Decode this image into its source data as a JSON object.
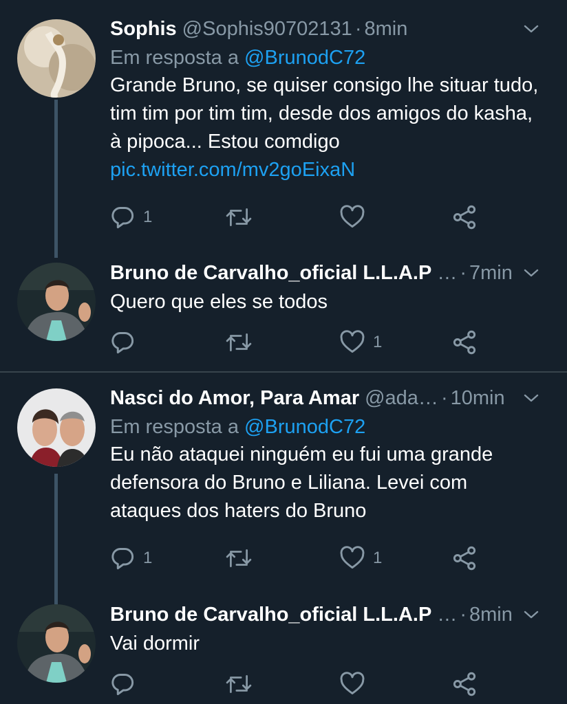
{
  "tweets": [
    {
      "name": "Sophis",
      "handle": "@Sophis90702131",
      "separator": "·",
      "time": "8min",
      "reply_prefix": "Em resposta a",
      "reply_to": "@BrunodC72",
      "text": "Grande Bruno, se quiser consigo lhe situar tudo, tim tim por tim tim, desde dos amigos do kasha, à pipoca... Estou comdigo",
      "link": "pic.twitter.com/mv2goEixaN",
      "replies": "1",
      "retweets": "",
      "likes": ""
    },
    {
      "name": "Bruno de Carvalho_oficial L.L.A.P",
      "handle": "…",
      "separator": "·",
      "time": "7min",
      "text": "Quero que eles se todos",
      "replies": "",
      "retweets": "",
      "likes": "1"
    },
    {
      "name": "Nasci do Amor, Para Amar",
      "handle": "@ada…",
      "separator": "·",
      "time": "10min",
      "reply_prefix": "Em resposta a",
      "reply_to": "@BrunodC72",
      "text": "Eu não ataquei ninguém eu fui uma grande defensora do Bruno e Liliana. Levei com ataques dos haters do Bruno",
      "replies": "1",
      "retweets": "",
      "likes": "1"
    },
    {
      "name": "Bruno de Carvalho_oficial L.L.A.P",
      "handle": "…",
      "separator": "·",
      "time": "8min",
      "text": "Vai dormir",
      "replies": "",
      "retweets": "",
      "likes": ""
    }
  ],
  "colors": {
    "background": "#15202b",
    "secondary_text": "#8899a6",
    "link": "#1da1f2",
    "thread_line": "#3d5466",
    "divider": "#38444d"
  },
  "icons": [
    "reply-icon",
    "retweet-icon",
    "like-icon",
    "share-icon",
    "chevron-down-icon"
  ]
}
